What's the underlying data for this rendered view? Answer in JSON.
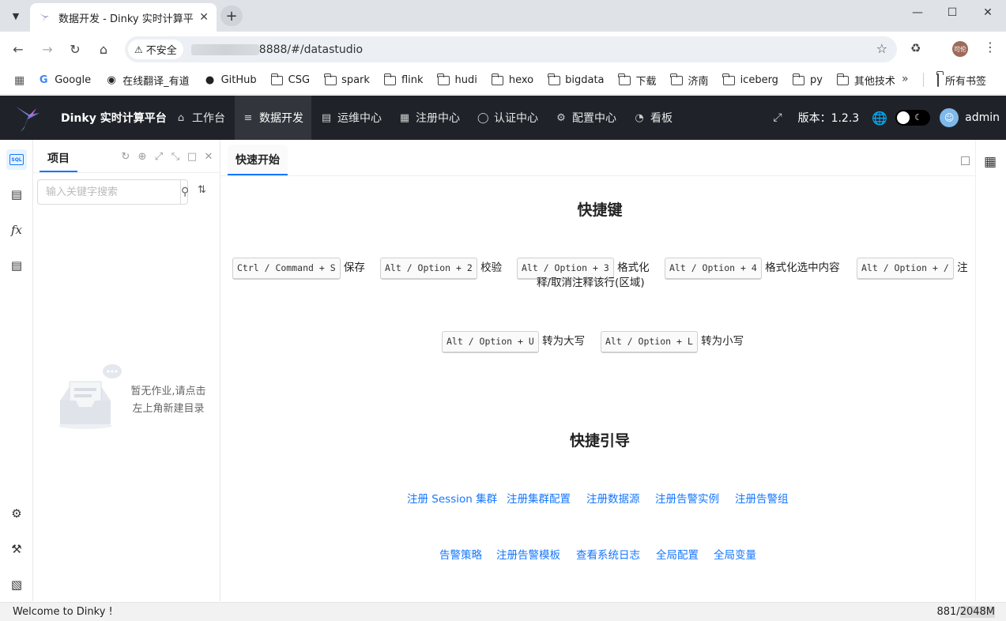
{
  "browser": {
    "tab_title": "数据开发 - Dinky 实时计算平台",
    "insecure_label": "不安全",
    "url": "8888/#/datastudio",
    "profile_label": "可伦",
    "bookmarks": [
      "Google",
      "在线翻译_有道",
      "GitHub",
      "CSG",
      "spark",
      "flink",
      "hudi",
      "hexo",
      "bigdata",
      "下载",
      "济南",
      "iceberg",
      "py",
      "其他技术"
    ],
    "all_bookmarks": "所有书签"
  },
  "app": {
    "brand": "Dinky 实时计算平台",
    "menu": [
      "工作台",
      "数据开发",
      "运维中心",
      "注册中心",
      "认证中心",
      "配置中心",
      "看板"
    ],
    "version": "版本：1.2.3",
    "username": "admin"
  },
  "panel": {
    "tab": "项目",
    "search_placeholder": "输入关键字搜索",
    "empty_text": "暂无作业,请点击左上角新建目录"
  },
  "main": {
    "tab": "快速开始",
    "shortcuts_title": "快捷键",
    "shortcuts": [
      {
        "keys": "Ctrl / Command + S",
        "desc": "保存"
      },
      {
        "keys": "Alt / Option + 2",
        "desc": "校验"
      },
      {
        "keys": "Alt / Option + 3",
        "desc": "格式化"
      },
      {
        "keys": "Alt / Option + 4",
        "desc": "格式化选中内容"
      },
      {
        "keys": "Alt / Option + /",
        "desc": "注释/取消注释该行(区域)"
      },
      {
        "keys": "Alt / Option + U",
        "desc": "转为大写"
      },
      {
        "keys": "Alt / Option + L",
        "desc": "转为小写"
      }
    ],
    "shortcut3_desc_line1": "格式化",
    "shortcut5_desc_tail": "注",
    "shortcut5_desc_line2": "释/取消注释该行(区域)",
    "guide_title": "快捷引导",
    "guide_links_row1": [
      "注册 Session 集群",
      "注册集群配置",
      "注册数据源",
      "注册告警实例",
      "注册告警组"
    ],
    "guide_links_row2": [
      "告警策略",
      "注册告警模板",
      "查看系统日志",
      "全局配置",
      "全局变量"
    ]
  },
  "footer": {
    "welcome": "Welcome to Dinky !",
    "mem_used": "881/",
    "mem_total": "2048M"
  }
}
